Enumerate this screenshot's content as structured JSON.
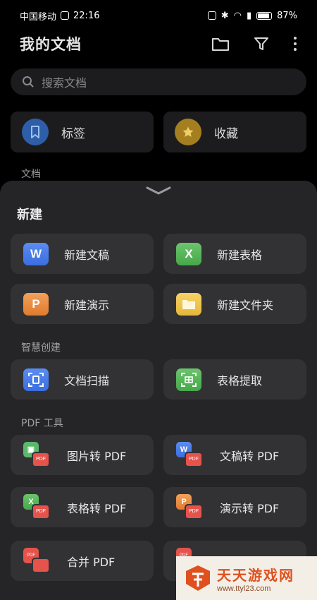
{
  "status_bar": {
    "carrier": "中国移动",
    "time": "22:16",
    "battery": "87%"
  },
  "header": {
    "title": "我的文档"
  },
  "search": {
    "placeholder": "搜索文档"
  },
  "quick": {
    "tags_label": "标签",
    "favorites_label": "收藏"
  },
  "section_docs": "文档",
  "sheet": {
    "title": "新建",
    "new_items": [
      {
        "label": "新建文稿",
        "icon_letter": "W"
      },
      {
        "label": "新建表格",
        "icon_letter": "X"
      },
      {
        "label": "新建演示",
        "icon_letter": "P"
      },
      {
        "label": "新建文件夹",
        "icon": "folder-icon"
      }
    ],
    "smart_title": "智慧创建",
    "smart_items": [
      {
        "label": "文档扫描",
        "icon": "scan-document-icon"
      },
      {
        "label": "表格提取",
        "icon": "table-extract-icon"
      }
    ],
    "pdf_title": "PDF 工具",
    "pdf_items": [
      {
        "label": "图片转 PDF",
        "badge": "PDF"
      },
      {
        "label": "文稿转 PDF",
        "icon_letter": "W",
        "badge": "PDF"
      },
      {
        "label": "表格转 PDF",
        "icon_letter": "X",
        "badge": "PDF"
      },
      {
        "label": "演示转 PDF",
        "icon_letter": "P",
        "badge": "PDF"
      },
      {
        "label": "合并 PDF",
        "badge": "PDF"
      }
    ]
  },
  "watermark": {
    "name": "天天游戏网",
    "url": "www.ttyl23.com"
  }
}
